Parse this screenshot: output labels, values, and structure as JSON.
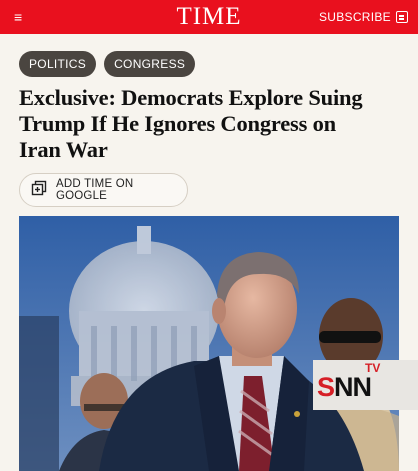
{
  "header": {
    "menu_icon": "menu-icon",
    "logo": "TIME",
    "subscribe_label": "SUBSCRIBE",
    "subscribe_icon": "newspaper-icon",
    "brand_color": "#e9101e"
  },
  "tags": [
    {
      "label": "POLITICS"
    },
    {
      "label": "CONGRESS"
    }
  ],
  "article": {
    "headline": "Exclusive: Democrats Explore Suing Trump If He Ignores Congress on Iran War"
  },
  "google_button": {
    "label": "ADD TIME ON GOOGLE",
    "icon": "add-source-icon"
  },
  "photo": {
    "watermark_text": "SNN",
    "watermark_sub": "TV"
  }
}
